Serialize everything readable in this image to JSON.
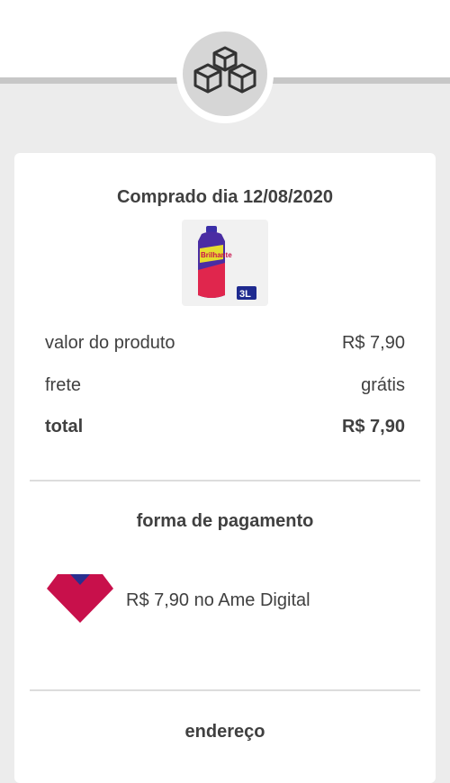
{
  "header": {
    "icon": "boxes-icon"
  },
  "order": {
    "purchase_date_label": "Comprado dia 12/08/2020",
    "product": {
      "image_icon": "detergent-bottle-icon",
      "brand_text": "Brilhante",
      "size_text": "3L"
    },
    "summary": {
      "product_value_label": "valor do produto",
      "product_value": "R$ 7,90",
      "shipping_label": "frete",
      "shipping_value": "grátis",
      "total_label": "total",
      "total_value": "R$ 7,90"
    }
  },
  "payment": {
    "section_title": "forma de pagamento",
    "method_icon": "ame-digital-logo-icon",
    "method_text": "R$ 7,90 no Ame Digital"
  },
  "address": {
    "section_title": "endereço"
  },
  "colors": {
    "background": "#ececec",
    "card": "#ffffff",
    "text": "#404040",
    "ame_red": "#c8104b",
    "ame_blue": "#2a2f8f"
  }
}
